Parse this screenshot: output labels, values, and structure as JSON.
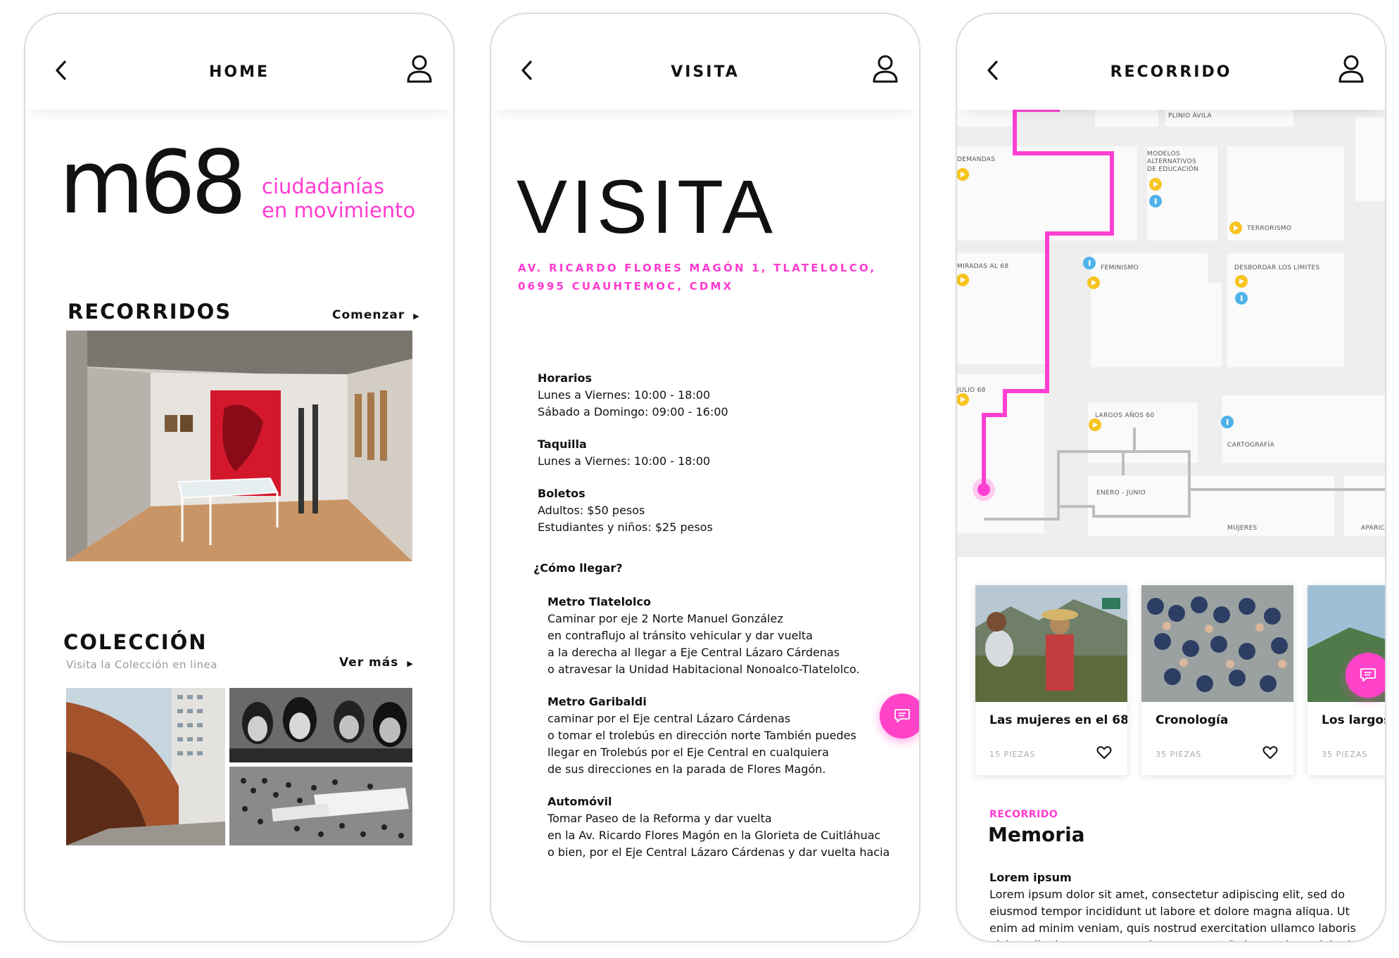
{
  "home": {
    "title": "HOME",
    "logo_text": "m68",
    "tagline_1": "ciudadanías",
    "tagline_2": "en movimiento",
    "recorridos": {
      "heading": "RECORRIDOS",
      "link": "Comenzar"
    },
    "coleccion": {
      "heading": "COLECCIÓN",
      "subtitle": "Visita la Colección en linea",
      "link": "Ver más"
    }
  },
  "visita": {
    "title": "VISITA",
    "big_title": "VISITA",
    "address_1": "AV. RICARDO FLORES MAGÓN 1, TLATELOLCO,",
    "address_2": "06995 CUAUHTEMOC, CDMX",
    "horarios": {
      "label": "Horarios",
      "l1": "Lunes a Viernes: 10:00 - 18:00",
      "l2": "Sábado a Domingo: 09:00 - 16:00"
    },
    "taquilla": {
      "label": "Taquilla",
      "l1": "Lunes a Viernes: 10:00 - 18:00"
    },
    "boletos": {
      "label": "Boletos",
      "l1": "Adultos: $50 pesos",
      "l2": "Estudiantes y niños: $25 pesos"
    },
    "como_llegar": "¿Cómo llegar?",
    "metro_tlatelolco": {
      "label": "Metro Tlatelolco",
      "l1": "Caminar por eje 2 Norte Manuel González",
      "l2": "en contraflujo al tránsito vehicular y dar vuelta",
      "l3": "a la derecha al llegar a Eje Central Lázaro Cárdenas",
      "l4": "o atravesar la Unidad Habitacional Nonoalco-Tlatelolco."
    },
    "metro_garibaldi": {
      "label": "Metro Garibaldi",
      "l1": "caminar por el Eje central Lázaro Cárdenas",
      "l2": "o tomar el trolebús en dirección norte También puedes",
      "l3": "llegar en Trolebús por el Eje Central en cualquiera",
      "l4": "de sus direcciones en la parada de Flores Magón."
    },
    "automovil": {
      "label": "Automóvil",
      "l1": "Tomar Paseo de la Reforma y dar vuelta",
      "l2": "en la Av. Ricardo Flores Magón en la Glorieta de Cuitláhuac",
      "l3": "o bien, por el Eje Central Lázaro Cárdenas y dar vuelta hacia"
    }
  },
  "recorrido": {
    "title": "RECORRIDO",
    "map_labels": {
      "plinio": "PLINIO ÁVILA",
      "demandas": "DEMANDAS",
      "modelos": "MODELOS ALTERNATIVOS DE EDUCACIÓN",
      "terrorismo": "TERRORISMO",
      "miradas": "MIRADAS AL 68",
      "feminismo": "FEMINISMO",
      "desbordar": "DESBORDAR LOS LÍMITES",
      "julio": "JULIO 68",
      "largos": "LARGOS AÑOS 60",
      "cartografia": "CARTOGRAFÍA",
      "enero": "ENERO - JUNIO",
      "mujeres": "MUJERES",
      "aparic": "APARIC"
    },
    "cards": [
      {
        "title": "Las mujeres en el 68",
        "count": "15 PIEZAS"
      },
      {
        "title": "Cronología",
        "count": "35 PIEZAS"
      },
      {
        "title": "Los largos a",
        "count": "35 PIEZAS"
      }
    ],
    "kicker": "RECORRIDO",
    "heading": "Memoria",
    "body_title": "Lorem ipsum",
    "body_1": "Lorem ipsum dolor sit amet, consectetur adipiscing elit, sed do",
    "body_2": "eiusmod tempor incididunt ut labore et dolore magna aliqua. Ut",
    "body_3": "enim ad minim veniam, quis nostrud exercitation ullamco laboris",
    "body_4": "nisi ut aliquip ex ea commodo consequat. Duis aute irure dolor in"
  },
  "colors": {
    "accent": "#ff3bd0",
    "yellow": "#f7c41f",
    "blue": "#4fb3ea",
    "map_bg": "#f0f0f0"
  }
}
